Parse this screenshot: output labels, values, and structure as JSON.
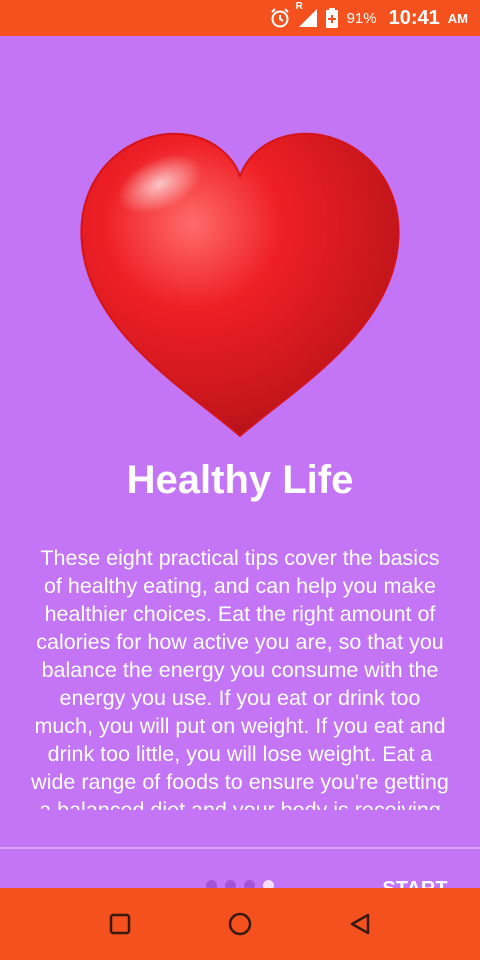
{
  "status_bar": {
    "icons": [
      "alarm-icon",
      "signal-icon",
      "battery-icon"
    ],
    "roaming_label": "R",
    "battery_percent": "91%",
    "time": "10:41",
    "ampm": "AM"
  },
  "onboarding": {
    "image": "heart-icon",
    "title": "Healthy Life",
    "description": "These eight practical tips cover the basics of healthy eating, and can help you make healthier choices. Eat the right amount of calories for how active you are, so that you balance the energy you consume with the energy you use. If you eat or drink too much, you will put on weight. If you eat and drink too little, you will lose weight. Eat a wide range of foods to ensure you're getting a balanced diet and your body is receiving all the nutrients it needs.",
    "page_count": 4,
    "current_page": 4,
    "start_label": "START"
  },
  "nav_bar": {
    "buttons": [
      "recents-square-icon",
      "home-circle-icon",
      "back-triangle-icon"
    ]
  },
  "colors": {
    "accent": "#f5511e",
    "background": "#c375f5",
    "heart": "#e31d24",
    "dot_inactive": "#a454d6",
    "dot_active": "#f3defc"
  }
}
